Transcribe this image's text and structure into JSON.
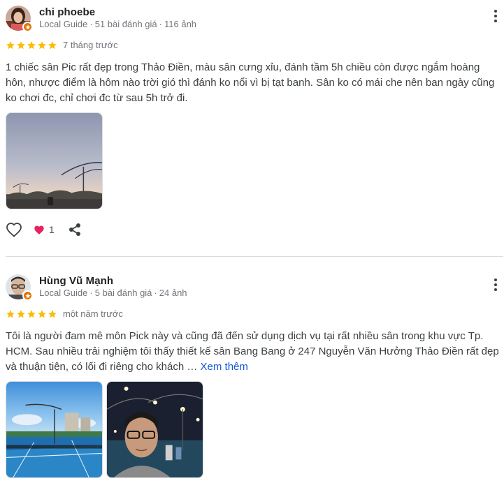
{
  "colors": {
    "star": "#fbbc04",
    "link": "#1558d6",
    "guide_badge": "#e37400",
    "heart": "#e5235f"
  },
  "reviews": [
    {
      "name": "chi phoebe",
      "guide_label": "Local Guide",
      "review_count": "51 bài đánh giá",
      "photo_count": "116 ảnh",
      "rating": 5,
      "when": "7 tháng trước",
      "text": "1 chiếc sân Pic rất đẹp trong Thảo Điền, màu sân cưng xỉu, đánh tầm 5h chiều còn được ngắm hoàng hôn, nhược điểm là hôm nào trời gió thì đánh ko nổi vì bị tạt banh. Sân ko có mái che nên ban ngày cũng ko chơi đc, chỉ chơi đc từ sau 5h trở đi.",
      "photos": [
        "sunset-court-photo"
      ],
      "reactions": {
        "like_icon": "heart-outline-icon",
        "love_icon": "heart-filled-icon",
        "love_count": "1",
        "share_icon": "share-icon"
      }
    },
    {
      "name": "Hùng Vũ Mạnh",
      "guide_label": "Local Guide",
      "review_count": "5 bài đánh giá",
      "photo_count": "24 ảnh",
      "rating": 5,
      "when": "một năm trước",
      "text": "Tôi là người đam mê môn Pick này và cũng đã đến sử dụng dịch vụ tại rất nhiều sân trong khu vực Tp. HCM. Sau nhiều trải nghiệm tôi thấy thiết kế sân Bang Bang ở 247 Nguyễn Văn Hưởng Thảo Điền rất đẹp và thuận tiện, có lối đi riêng cho khách …",
      "see_more": "Xem thêm",
      "photos": [
        "daytime-courts-photo",
        "night-selfie-photo"
      ]
    }
  ]
}
